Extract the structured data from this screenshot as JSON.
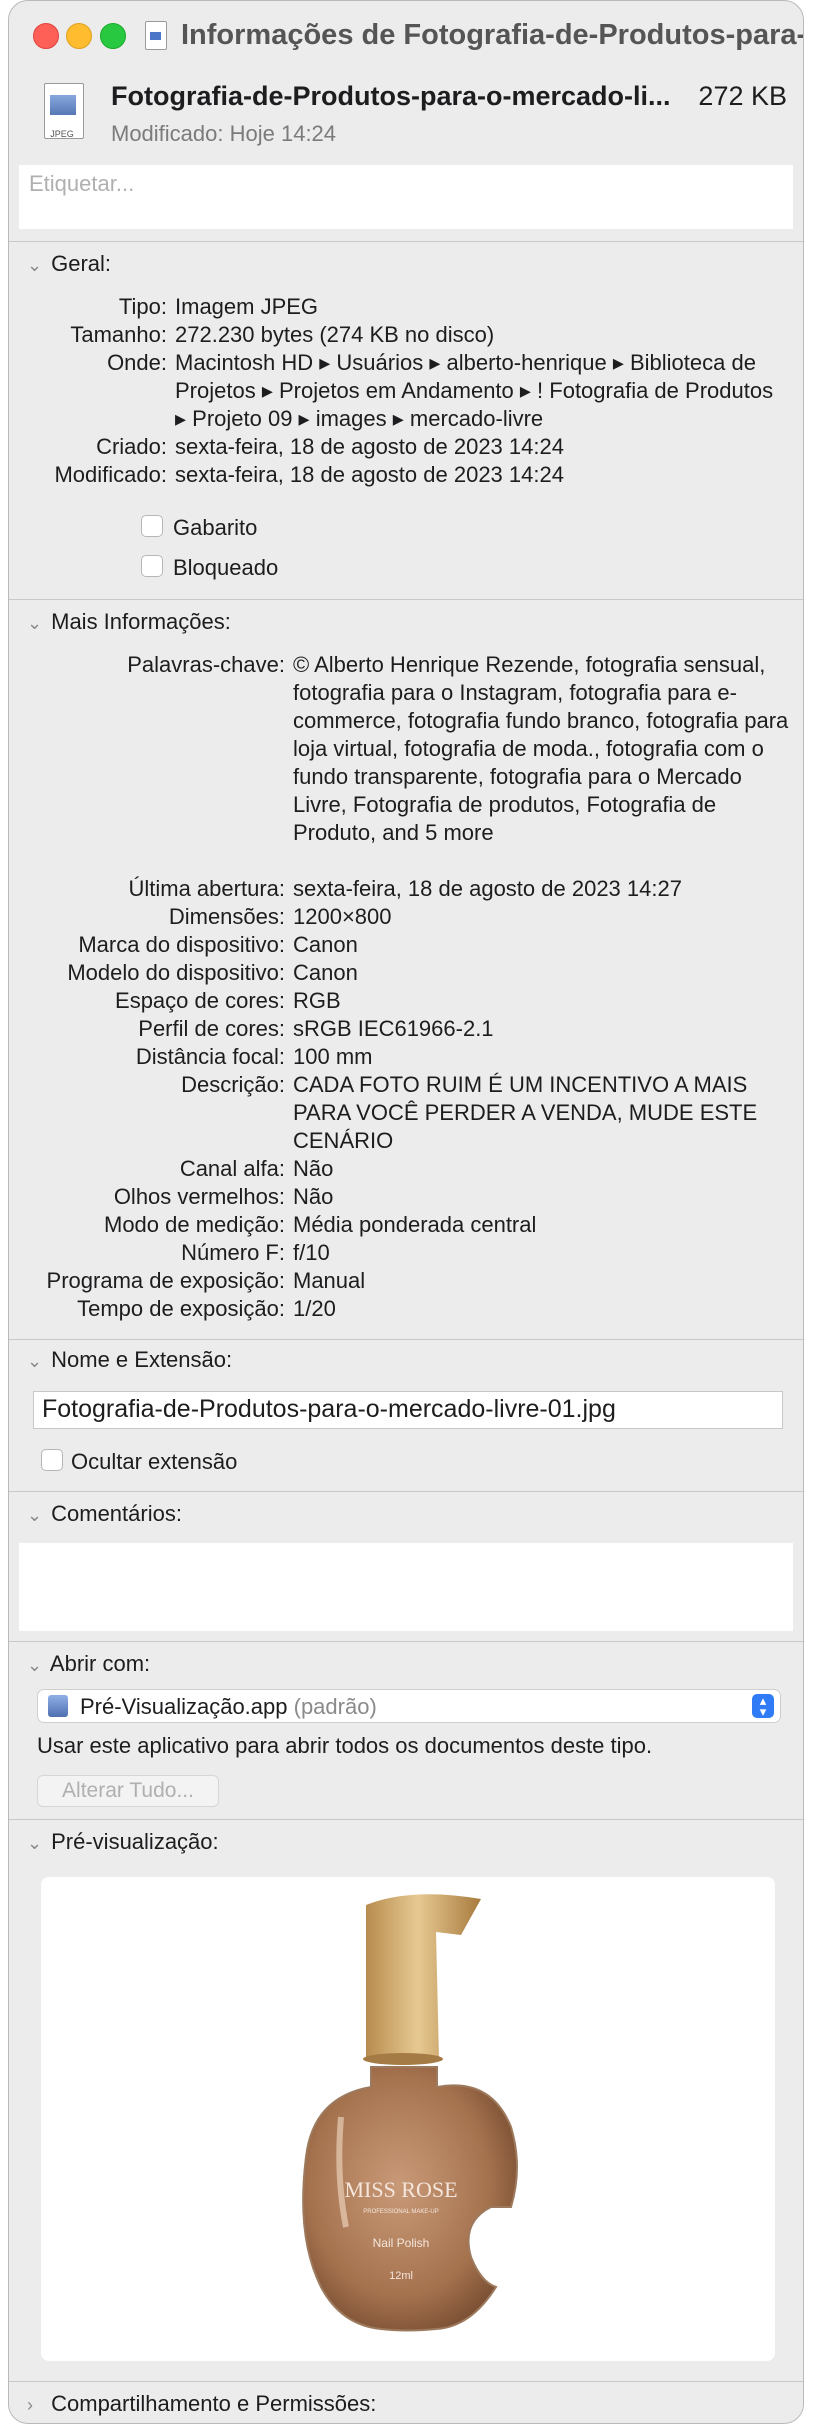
{
  "window": {
    "title": "Informações de Fotografia-de-Produtos-para-..."
  },
  "header": {
    "icon_label": "JPEG",
    "file_name": "Fotografia-de-Produtos-para-o-mercado-li...",
    "file_size": "272 KB",
    "modified": "Modificado: Hoje 14:24",
    "tags_placeholder": "Etiquetar..."
  },
  "general": {
    "title": "Geral:",
    "rows": [
      {
        "key": "Tipo:",
        "value": "Imagem JPEG"
      },
      {
        "key": "Tamanho:",
        "value": "272.230 bytes (274 KB no disco)"
      },
      {
        "key": "Onde:",
        "value": "Macintosh HD ▸ Usuários ▸ alberto-henrique ▸ Biblioteca de Projetos ▸ Projetos em Andamento ▸ ! Fotografia de Produtos ▸ Projeto 09 ▸ images ▸ mercado-livre"
      },
      {
        "key": "Criado:",
        "value": "sexta-feira, 18 de agosto de 2023 14:24"
      },
      {
        "key": "Modificado:",
        "value": "sexta-feira, 18 de agosto de 2023 14:24"
      }
    ],
    "stationery_label": "Gabarito",
    "locked_label": "Bloqueado"
  },
  "more_info": {
    "title": "Mais Informações:",
    "rows": [
      {
        "key": "Palavras-chave:",
        "value": "© Alberto Henrique Rezende, fotografia sensual, fotografia para o Instagram, fotografia para e-commerce, fotografia fundo branco, fotografia para loja virtual, fotografia de moda., fotografia com o fundo transparente, fotografia para o Mercado Livre, Fotografia de produtos, Fotografia de Produto, and 5 more"
      },
      {
        "key": "Última abertura:",
        "value": "sexta-feira, 18 de agosto de 2023 14:27"
      },
      {
        "key": "Dimensões:",
        "value": "1200×800"
      },
      {
        "key": "Marca do dispositivo:",
        "value": "Canon"
      },
      {
        "key": "Modelo do dispositivo:",
        "value": "Canon"
      },
      {
        "key": "Espaço de cores:",
        "value": "RGB"
      },
      {
        "key": "Perfil de cores:",
        "value": "sRGB IEC61966-2.1"
      },
      {
        "key": "Distância focal:",
        "value": "100 mm"
      },
      {
        "key": "Descrição:",
        "value": "CADA FOTO RUIM É UM INCENTIVO A MAIS PARA VOCÊ PERDER A VENDA, MUDE ESTE CENÁRIO"
      },
      {
        "key": "Canal alfa:",
        "value": "Não"
      },
      {
        "key": "Olhos vermelhos:",
        "value": "Não"
      },
      {
        "key": "Modo de medição:",
        "value": "Média ponderada central"
      },
      {
        "key": "Número F:",
        "value": "f/10"
      },
      {
        "key": "Programa de exposição:",
        "value": "Manual"
      },
      {
        "key": "Tempo de exposição:",
        "value": "1/20"
      }
    ]
  },
  "name_ext": {
    "title": "Nome e Extensão:",
    "value": "Fotografia-de-Produtos-para-o-mercado-livre-01.jpg",
    "hide_ext_label": "Ocultar extensão"
  },
  "comments": {
    "title": "Comentários:"
  },
  "open_with": {
    "title": "Abrir com:",
    "app": "Pré-Visualização.app",
    "default_tag": "(padrão)",
    "note": "Usar este aplicativo para abrir todos os documentos deste tipo.",
    "change_all": "Alterar Tudo..."
  },
  "preview": {
    "title": "Pré-visualização:",
    "product_brand": "MISS ROSE",
    "product_sub": "PROFESSIONAL MAKE-UP",
    "product_type": "Nail Polish",
    "product_volume": "12ml"
  },
  "sharing": {
    "title": "Compartilhamento e Permissões:"
  }
}
